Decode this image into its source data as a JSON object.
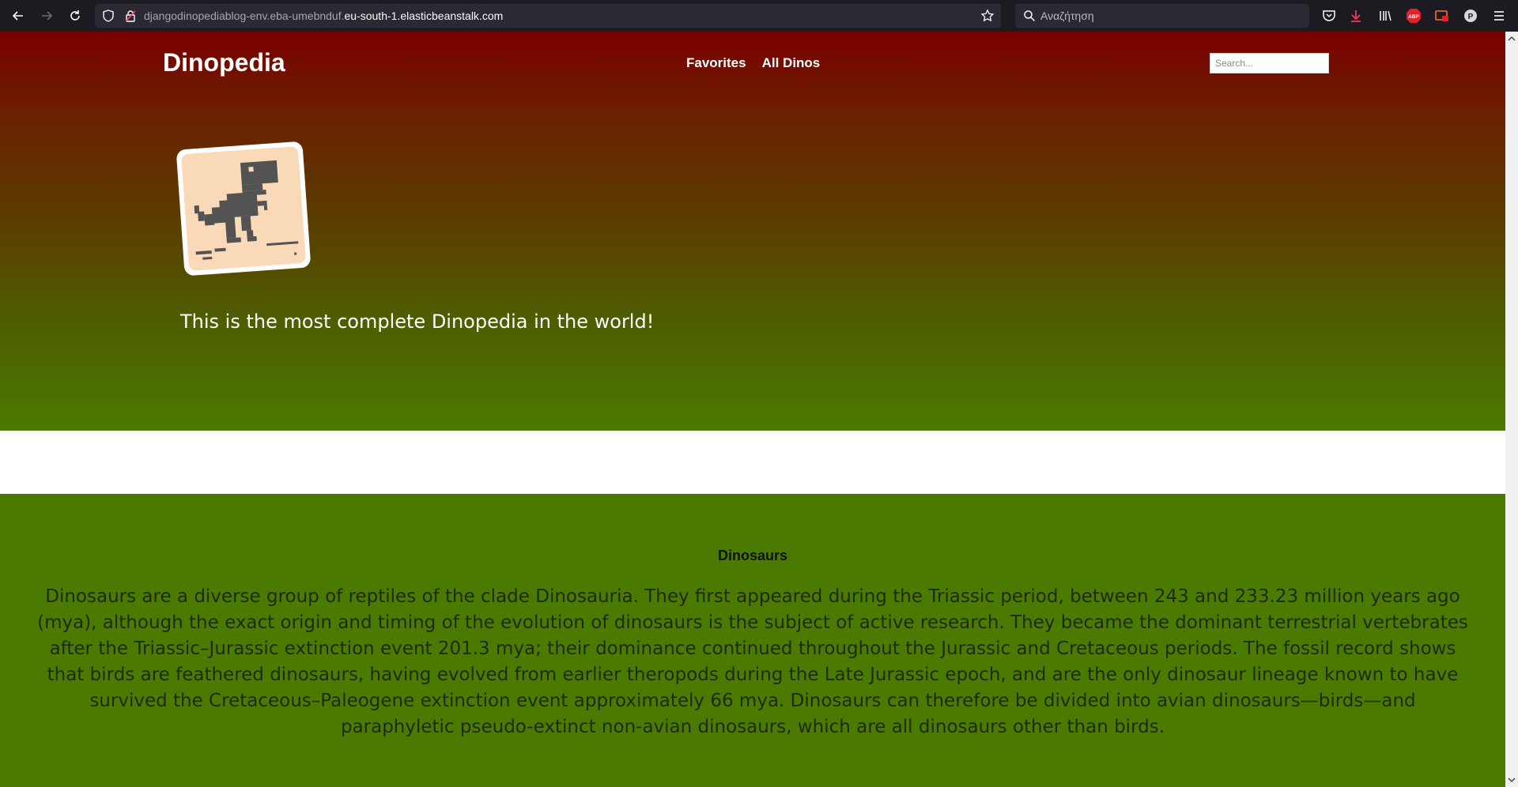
{
  "browser": {
    "url_subdomain": "djangodinopediablog-env.eba-umebnduf.",
    "url_domain": "eu-south-1.elasticbeanstalk.com",
    "search_placeholder": "Αναζήτηση",
    "extension_icons": [
      "pocket-icon",
      "download-icon",
      "library-icon",
      "adblock-plus-icon",
      "screen-share-icon",
      "profile-icon",
      "menu-icon"
    ],
    "accent_colors": {
      "download": "#ff3b5c",
      "adblock": "#e4212b"
    }
  },
  "site": {
    "brand": "Dinopedia",
    "nav": {
      "favorites": "Favorites",
      "all_dinos": "All Dinos"
    },
    "search_placeholder": "Search...",
    "tagline": "This is the most complete Dinopedia in the world!",
    "logo_icon": "dino-logo-icon",
    "colors": {
      "hero_top": "#7a0000",
      "hero_bottom": "#4a7a00",
      "section_bg": "#4a7a00"
    }
  },
  "section": {
    "title": "Dinosaurs",
    "body": "Dinosaurs are a diverse group of reptiles of the clade Dinosauria. They first appeared during the Triassic period, between 243 and 233.23 million years ago (mya), although the exact origin and timing of the evolution of dinosaurs is the subject of active research. They became the dominant terrestrial vertebrates after the Triassic–Jurassic extinction event 201.3 mya; their dominance continued throughout the Jurassic and Cretaceous periods. The fossil record shows that birds are feathered dinosaurs, having evolved from earlier theropods during the Late Jurassic epoch, and are the only dinosaur lineage known to have survived the Cretaceous–Paleogene extinction event approximately 66 mya. Dinosaurs can therefore be divided into avian dinosaurs—birds—and paraphyletic pseudo-extinct non-avian dinosaurs, which are all dinosaurs other than birds."
  }
}
